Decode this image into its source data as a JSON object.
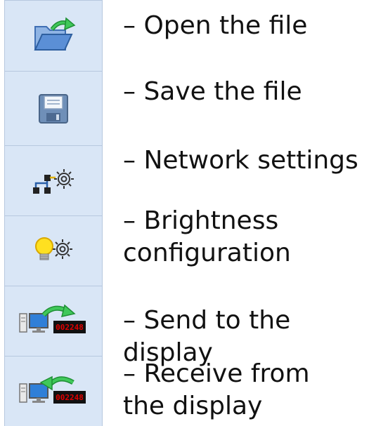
{
  "toolbar": {
    "items": [
      {
        "label": "– Open the file",
        "icon": "open-folder-icon"
      },
      {
        "label": "– Save the file",
        "icon": "save-disk-icon"
      },
      {
        "label": "– Network settings",
        "icon": "network-settings-icon"
      },
      {
        "label": "– Brightness configuration",
        "icon": "brightness-settings-icon"
      },
      {
        "label": "– Send to the display",
        "icon": "send-to-display-icon",
        "display_readout": "002248"
      },
      {
        "label": "– Receive from the display",
        "icon": "receive-from-display-icon",
        "display_readout": "002248"
      }
    ]
  },
  "colors": {
    "toolbar_bg": "#d9e6f6",
    "toolbar_border": "#b7c8df",
    "arrow_green": "#2fb84a",
    "folder_blue": "#5b8fd6",
    "bulb_yellow": "#ffe020",
    "display_red": "#e00000"
  }
}
